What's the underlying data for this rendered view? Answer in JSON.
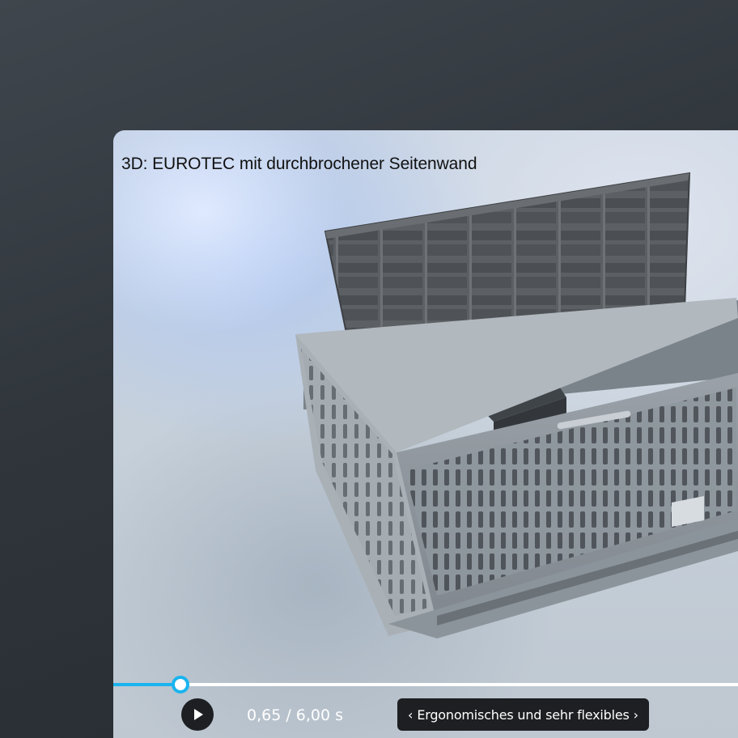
{
  "viewer": {
    "title": "3D: EUROTEC mit durchbrochener Seitenwand"
  },
  "playback": {
    "time_display": "0,65 / 6,00 s",
    "progress": 0.108
  },
  "chapter": {
    "label": "Ergonomisches und sehr flexibles",
    "prev_icon": "chevron-left-icon",
    "next_icon": "chevron-right-icon"
  },
  "colors": {
    "accent": "#1ab4ee",
    "control_bg": "#1d1f22",
    "crate_body": "#8e959c",
    "crate_lid": "#55595d"
  }
}
